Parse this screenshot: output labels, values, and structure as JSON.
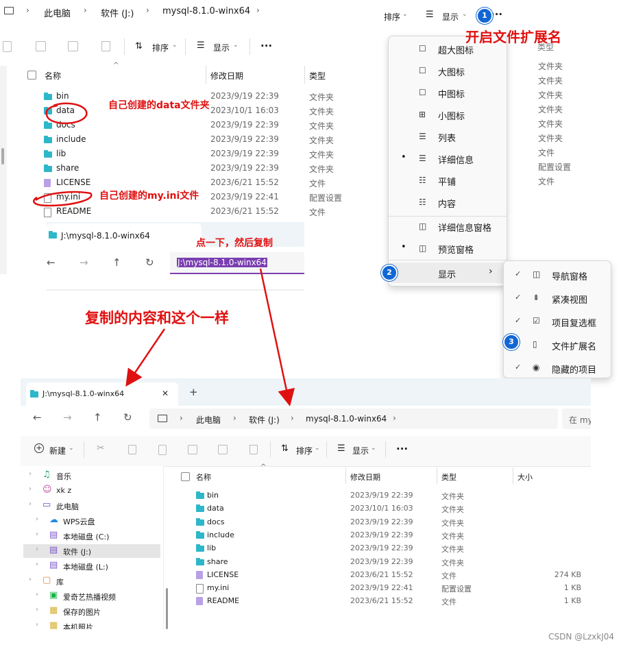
{
  "top": {
    "breadcrumb": [
      "此电脑",
      "软件 (J:)",
      "mysql-8.1.0-winx64"
    ],
    "sort_label": "排序",
    "view_label": "显示",
    "more": "···",
    "columns": {
      "name": "名称",
      "date": "修改日期",
      "type": "类型"
    },
    "files": [
      {
        "name": "bin",
        "date": "2023/9/19 22:39",
        "type": "文件夹",
        "icon": "folder"
      },
      {
        "name": "data",
        "date": "2023/10/1 16:03",
        "type": "文件夹",
        "icon": "folder"
      },
      {
        "name": "docs",
        "date": "2023/9/19 22:39",
        "type": "文件夹",
        "icon": "folder"
      },
      {
        "name": "include",
        "date": "2023/9/19 22:39",
        "type": "文件夹",
        "icon": "folder"
      },
      {
        "name": "lib",
        "date": "2023/9/19 22:39",
        "type": "文件夹",
        "icon": "folder"
      },
      {
        "name": "share",
        "date": "2023/9/19 22:39",
        "type": "文件夹",
        "icon": "folder"
      },
      {
        "name": "LICENSE",
        "date": "2023/6/21 15:52",
        "type": "文件",
        "icon": "license"
      },
      {
        "name": "my.ini",
        "date": "2023/9/19 22:41",
        "type": "配置设置",
        "icon": "ini"
      },
      {
        "name": "README",
        "date": "2023/6/21 15:52",
        "type": "文件",
        "icon": "file"
      }
    ]
  },
  "mid": {
    "tab_title": "J:\\mysql-8.1.0-winx64",
    "address": "J:\\mysql-8.1.0-winx64"
  },
  "menu": {
    "sort_label": "排序",
    "view_label": "显示",
    "more": "···",
    "header_type": "类型",
    "items": [
      {
        "label": "超大图标",
        "icon": "☐",
        "dot": ""
      },
      {
        "label": "大图标",
        "icon": "☐",
        "dot": ""
      },
      {
        "label": "中图标",
        "icon": "☐",
        "dot": ""
      },
      {
        "label": "小图标",
        "icon": "⊞",
        "dot": ""
      },
      {
        "label": "列表",
        "icon": "☰",
        "dot": ""
      },
      {
        "label": "详细信息",
        "icon": "☰",
        "dot": "•"
      },
      {
        "label": "平铺",
        "icon": "☷",
        "dot": ""
      },
      {
        "label": "内容",
        "icon": "☷",
        "dot": ""
      },
      {
        "label": "详细信息窗格",
        "icon": "◫",
        "dot": ""
      },
      {
        "label": "预览窗格",
        "icon": "◫",
        "dot": "•"
      }
    ],
    "show_label": "显示",
    "arrow": "›",
    "right_types": [
      "文件夹",
      "文件夹",
      "文件夹",
      "文件夹",
      "文件夹",
      "文件夹",
      "文件",
      "配置设置",
      "文件"
    ],
    "submenu": [
      {
        "label": "导航窗格",
        "check": "✓",
        "icon": "◫"
      },
      {
        "label": "紧凑视图",
        "check": "✓",
        "icon": "⇟"
      },
      {
        "label": "项目复选框",
        "check": "✓",
        "icon": "☑"
      },
      {
        "label": "文件扩展名",
        "check": "",
        "icon": "▯"
      },
      {
        "label": "隐藏的项目",
        "check": "✓",
        "icon": "◉"
      }
    ]
  },
  "annotations": {
    "enable_ext": "开启文件扩展名",
    "data_folder": "自己创建的data文件夹",
    "my_ini": "自己创建的my.ini文件",
    "click_copy": "点一下，然后复制",
    "same_content": "复制的内容和这个一样",
    "badge1": "1",
    "badge2": "2",
    "badge3": "3"
  },
  "bottom": {
    "tab_title": "J:\\mysql-8.1.0-winx64",
    "close": "✕",
    "plus": "+",
    "breadcrumb": [
      "此电脑",
      "软件 (J:)",
      "mysql-8.1.0-winx64"
    ],
    "search_placeholder": "在 my",
    "new_label": "新建",
    "sort_label": "排序",
    "view_label": "显示",
    "more": "···",
    "columns": {
      "name": "名称",
      "date": "修改日期",
      "type": "类型",
      "size": "大小"
    },
    "tree": [
      {
        "label": "音乐",
        "indent": 0,
        "icon": "♫",
        "color": "#1a9e5c"
      },
      {
        "label": "xk z",
        "indent": 0,
        "icon": "☺",
        "color": "#c04a9c"
      },
      {
        "label": "此电脑",
        "indent": 0,
        "icon": "▭",
        "color": "#6a4fc7"
      },
      {
        "label": "WPS云盘",
        "indent": 1,
        "icon": "☁",
        "color": "#1f8ae6"
      },
      {
        "label": "本地磁盘 (C:)",
        "indent": 1,
        "icon": "▤",
        "color": "#7b55cc"
      },
      {
        "label": "软件 (J:)",
        "indent": 1,
        "icon": "▤",
        "color": "#7b55cc"
      },
      {
        "label": "本地磁盘 (L:)",
        "indent": 1,
        "icon": "▤",
        "color": "#7b55cc"
      },
      {
        "label": "库",
        "indent": 0,
        "icon": "▢",
        "color": "#e0873c"
      },
      {
        "label": "爱奇艺热播视频",
        "indent": 1,
        "icon": "▣",
        "color": "#19b34a"
      },
      {
        "label": "保存的图片",
        "indent": 1,
        "icon": "▦",
        "color": "#d4b030"
      },
      {
        "label": "本机照片",
        "indent": 1,
        "icon": "▦",
        "color": "#d4b030"
      }
    ],
    "files": [
      {
        "name": "bin",
        "date": "2023/9/19 22:39",
        "type": "文件夹",
        "size": "",
        "icon": "folder"
      },
      {
        "name": "data",
        "date": "2023/10/1 16:03",
        "type": "文件夹",
        "size": "",
        "icon": "folder"
      },
      {
        "name": "docs",
        "date": "2023/9/19 22:39",
        "type": "文件夹",
        "size": "",
        "icon": "folder"
      },
      {
        "name": "include",
        "date": "2023/9/19 22:39",
        "type": "文件夹",
        "size": "",
        "icon": "folder"
      },
      {
        "name": "lib",
        "date": "2023/9/19 22:39",
        "type": "文件夹",
        "size": "",
        "icon": "folder"
      },
      {
        "name": "share",
        "date": "2023/9/19 22:39",
        "type": "文件夹",
        "size": "",
        "icon": "folder"
      },
      {
        "name": "LICENSE",
        "date": "2023/6/21 15:52",
        "type": "文件",
        "size": "274 KB",
        "icon": "license"
      },
      {
        "name": "my.ini",
        "date": "2023/9/19 22:41",
        "type": "配置设置",
        "size": "1 KB",
        "icon": "ini"
      },
      {
        "name": "README",
        "date": "2023/6/21 15:52",
        "type": "文件",
        "size": "1 KB",
        "icon": "license"
      }
    ]
  },
  "watermark": "CSDN @LzxkJ04",
  "colors": {
    "accent": "#1266d4",
    "annotation": "#e01010",
    "folder": "#2db7c9",
    "selection": "#7a3fb0"
  }
}
